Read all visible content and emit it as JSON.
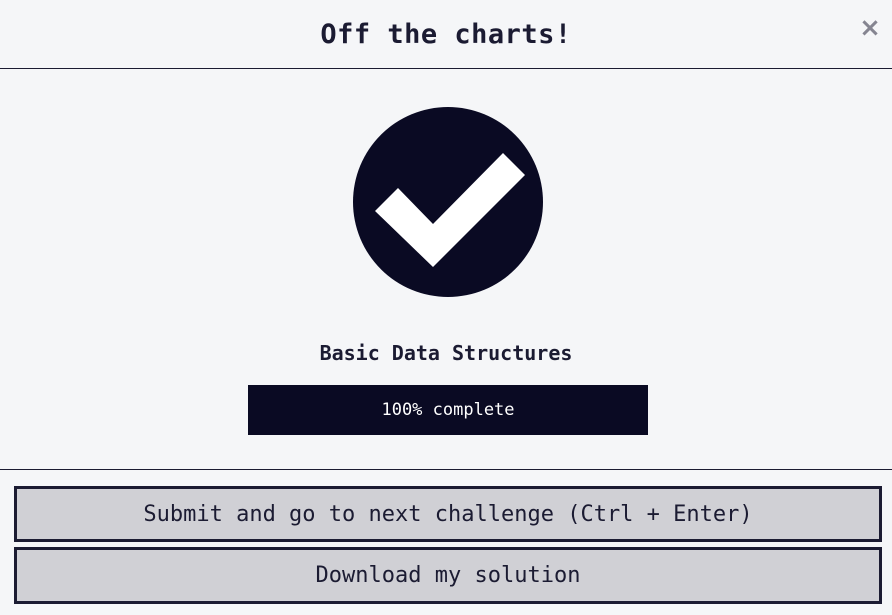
{
  "modal": {
    "title": "Off the charts!",
    "close_label": "×"
  },
  "challenge": {
    "name": "Basic Data Structures",
    "progress_percent": 100,
    "progress_label": "100% complete"
  },
  "icons": {
    "success": "check-circle-icon"
  },
  "colors": {
    "accent_dark": "#0a0a23",
    "button_bg": "#d0d0d5",
    "background": "#f5f6f8"
  },
  "buttons": {
    "submit_label": "Submit and go to next challenge (Ctrl + Enter)",
    "download_label": "Download my solution"
  }
}
